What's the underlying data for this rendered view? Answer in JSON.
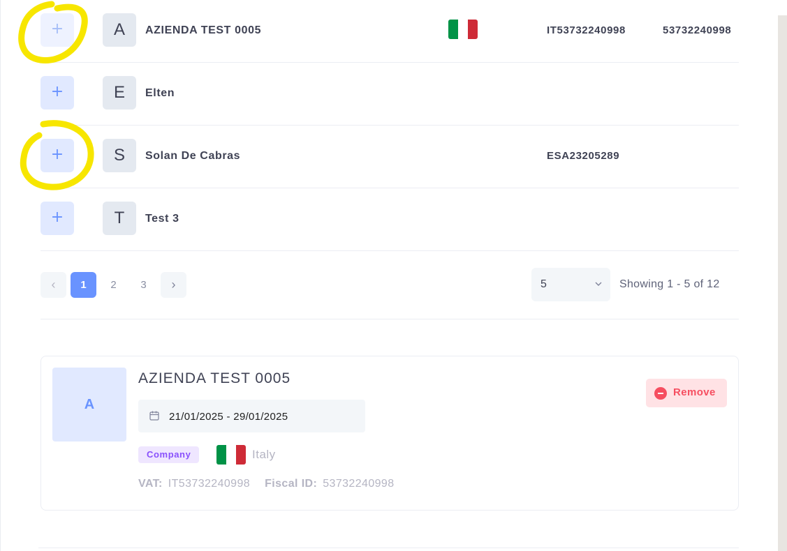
{
  "rows": [
    {
      "initial": "A",
      "name": "AZIENDA TEST 0005",
      "has_flag": true,
      "vat": "IT53732240998",
      "fiscal_id": "53732240998"
    },
    {
      "initial": "E",
      "name": "Elten",
      "has_flag": false,
      "vat": "",
      "fiscal_id": ""
    },
    {
      "initial": "S",
      "name": "Solan De Cabras",
      "has_flag": false,
      "vat": "ESA23205289",
      "fiscal_id": ""
    },
    {
      "initial": "T",
      "name": "Test 3",
      "has_flag": false,
      "vat": "",
      "fiscal_id": ""
    }
  ],
  "add_symbol": "+",
  "pagination": {
    "prev": "‹",
    "next": "›",
    "pages": [
      "1",
      "2",
      "3"
    ],
    "active_page": "1",
    "page_size": "5",
    "showing": "Showing 1 - 5 of 12"
  },
  "selected": {
    "initial": "A",
    "name": "AZIENDA TEST 0005",
    "date_range": "21/01/2025 - 29/01/2025",
    "type_badge": "Company",
    "country": "Italy",
    "vat_label": "VAT:",
    "vat": "IT53732240998",
    "fiscal_label": "Fiscal ID:",
    "fiscal_id": "53732240998",
    "remove_label": "Remove"
  },
  "colors": {
    "primary": "#6993ff",
    "danger": "#f64e60",
    "badge": "#8950fc",
    "highlight": "#f7e600",
    "flag_green": "#009246",
    "flag_white": "#ffffff",
    "flag_red": "#ce2b37"
  }
}
